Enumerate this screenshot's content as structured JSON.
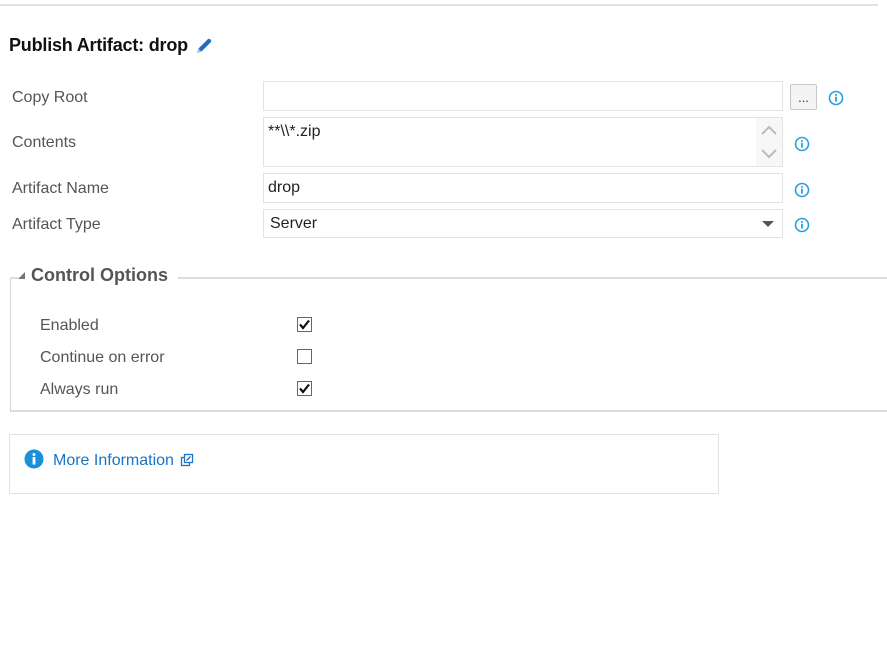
{
  "header": {
    "title": "Publish Artifact: drop",
    "edit_icon": "pencil-icon"
  },
  "fields": {
    "copy_root": {
      "label": "Copy Root",
      "value": "",
      "browse_label": "..."
    },
    "contents": {
      "label": "Contents",
      "value": "**\\\\*.zip"
    },
    "artifact_name": {
      "label": "Artifact Name",
      "value": "drop"
    },
    "artifact_type": {
      "label": "Artifact Type",
      "value": "Server"
    }
  },
  "control_options": {
    "title": "Control Options",
    "options": [
      {
        "label": "Enabled",
        "checked": true
      },
      {
        "label": "Continue on error",
        "checked": false
      },
      {
        "label": "Always run",
        "checked": true
      }
    ]
  },
  "more_info": {
    "label": "More Information",
    "icon": "info-icon",
    "external_icon": "external-link-icon"
  },
  "colors": {
    "accent": "#1b74c2",
    "info_icon": "#2a9ee3",
    "pencil": "#1f6dbf"
  }
}
